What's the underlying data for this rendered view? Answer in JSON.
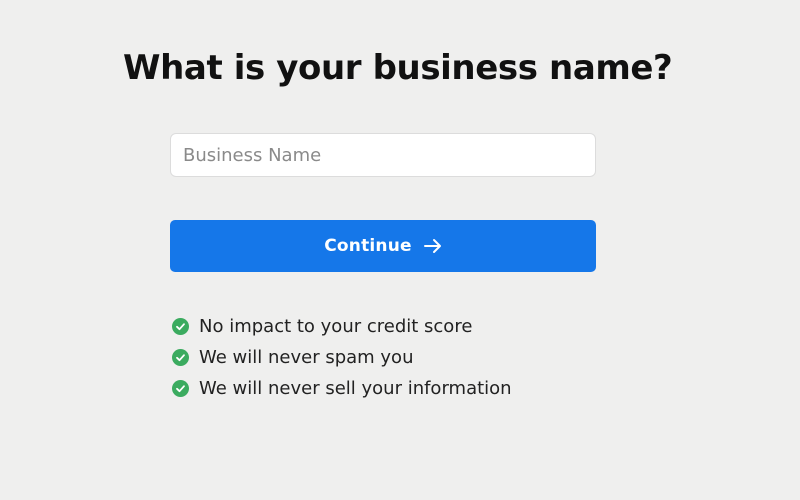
{
  "heading": "What is your business name?",
  "form": {
    "business_name": {
      "value": "",
      "placeholder": "Business Name"
    },
    "continue_label": "Continue",
    "continue_icon": "arrow-right-icon"
  },
  "benefits": [
    {
      "icon": "check-circle-icon",
      "text": "No impact to your credit score"
    },
    {
      "icon": "check-circle-icon",
      "text": "We will never spam you"
    },
    {
      "icon": "check-circle-icon",
      "text": "We will never sell your information"
    }
  ],
  "colors": {
    "background": "#efefee",
    "primary": "#1577e9",
    "check": "#3bab5f",
    "heading": "#111111"
  }
}
